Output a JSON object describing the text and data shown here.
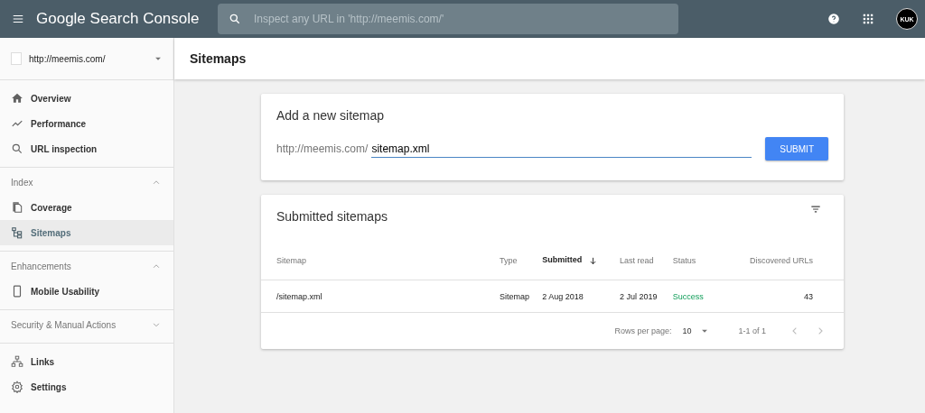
{
  "header": {
    "title": "Google Search Console",
    "search": {
      "placeholder": "Inspect any URL in 'http://meemis.com/'"
    },
    "avatar": "KUK"
  },
  "sidebar": {
    "property": "http://meemis.com/",
    "sections": [
      {
        "items": [
          {
            "label": "Overview",
            "selected": false
          },
          {
            "label": "Performance",
            "selected": false
          },
          {
            "label": "URL inspection",
            "selected": false
          }
        ]
      },
      {
        "header": "Index",
        "expanded": true,
        "items": [
          {
            "label": "Coverage",
            "selected": false
          },
          {
            "label": "Sitemaps",
            "selected": true
          }
        ]
      },
      {
        "header": "Enhancements",
        "expanded": true,
        "items": [
          {
            "label": "Mobile Usability",
            "selected": false
          }
        ]
      },
      {
        "header": "Security & Manual Actions",
        "expanded": false
      },
      {
        "items": [
          {
            "label": "Links",
            "selected": false
          },
          {
            "label": "Settings",
            "selected": false
          }
        ]
      }
    ]
  },
  "page_title": "Sitemaps",
  "add_card": {
    "title": "Add a new sitemap",
    "prefix": "http://meemis.com/",
    "value": "sitemap.xml",
    "button": "SUBMIT"
  },
  "submitted_card": {
    "title": "Submitted sitemaps",
    "columns": [
      {
        "label": "Sitemap",
        "sorted": false
      },
      {
        "label": "Type",
        "sorted": false
      },
      {
        "label": "Submitted",
        "sorted": true
      },
      {
        "label": "Last read",
        "sorted": false
      },
      {
        "label": "Status",
        "sorted": false
      },
      {
        "label": "Discovered URLs",
        "sorted": false
      }
    ],
    "rows": [
      {
        "cells": [
          "/sitemap.xml",
          "Sitemap",
          "2 Aug 2018",
          "2 Jul 2019",
          "Success",
          "43"
        ]
      }
    ],
    "pagination": {
      "rows_label": "Rows per page:",
      "rows_value": "10",
      "range": "1-1 of 1"
    }
  }
}
